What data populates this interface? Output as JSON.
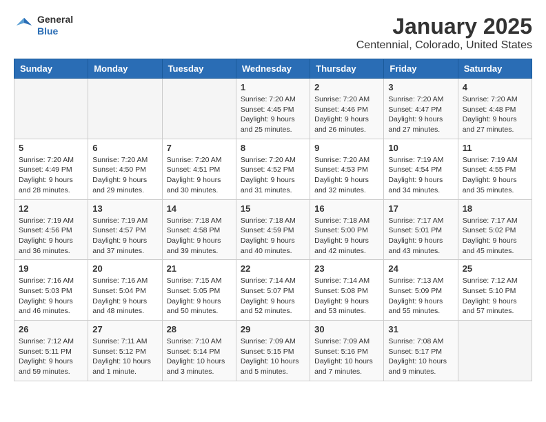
{
  "header": {
    "logo": {
      "general": "General",
      "blue": "Blue"
    },
    "title": "January 2025",
    "subtitle": "Centennial, Colorado, United States"
  },
  "weekdays": [
    "Sunday",
    "Monday",
    "Tuesday",
    "Wednesday",
    "Thursday",
    "Friday",
    "Saturday"
  ],
  "weeks": [
    [
      {
        "day": "",
        "sunrise": "",
        "sunset": "",
        "daylight": ""
      },
      {
        "day": "",
        "sunrise": "",
        "sunset": "",
        "daylight": ""
      },
      {
        "day": "",
        "sunrise": "",
        "sunset": "",
        "daylight": ""
      },
      {
        "day": "1",
        "sunrise": "Sunrise: 7:20 AM",
        "sunset": "Sunset: 4:45 PM",
        "daylight": "Daylight: 9 hours and 25 minutes."
      },
      {
        "day": "2",
        "sunrise": "Sunrise: 7:20 AM",
        "sunset": "Sunset: 4:46 PM",
        "daylight": "Daylight: 9 hours and 26 minutes."
      },
      {
        "day": "3",
        "sunrise": "Sunrise: 7:20 AM",
        "sunset": "Sunset: 4:47 PM",
        "daylight": "Daylight: 9 hours and 27 minutes."
      },
      {
        "day": "4",
        "sunrise": "Sunrise: 7:20 AM",
        "sunset": "Sunset: 4:48 PM",
        "daylight": "Daylight: 9 hours and 27 minutes."
      }
    ],
    [
      {
        "day": "5",
        "sunrise": "Sunrise: 7:20 AM",
        "sunset": "Sunset: 4:49 PM",
        "daylight": "Daylight: 9 hours and 28 minutes."
      },
      {
        "day": "6",
        "sunrise": "Sunrise: 7:20 AM",
        "sunset": "Sunset: 4:50 PM",
        "daylight": "Daylight: 9 hours and 29 minutes."
      },
      {
        "day": "7",
        "sunrise": "Sunrise: 7:20 AM",
        "sunset": "Sunset: 4:51 PM",
        "daylight": "Daylight: 9 hours and 30 minutes."
      },
      {
        "day": "8",
        "sunrise": "Sunrise: 7:20 AM",
        "sunset": "Sunset: 4:52 PM",
        "daylight": "Daylight: 9 hours and 31 minutes."
      },
      {
        "day": "9",
        "sunrise": "Sunrise: 7:20 AM",
        "sunset": "Sunset: 4:53 PM",
        "daylight": "Daylight: 9 hours and 32 minutes."
      },
      {
        "day": "10",
        "sunrise": "Sunrise: 7:19 AM",
        "sunset": "Sunset: 4:54 PM",
        "daylight": "Daylight: 9 hours and 34 minutes."
      },
      {
        "day": "11",
        "sunrise": "Sunrise: 7:19 AM",
        "sunset": "Sunset: 4:55 PM",
        "daylight": "Daylight: 9 hours and 35 minutes."
      }
    ],
    [
      {
        "day": "12",
        "sunrise": "Sunrise: 7:19 AM",
        "sunset": "Sunset: 4:56 PM",
        "daylight": "Daylight: 9 hours and 36 minutes."
      },
      {
        "day": "13",
        "sunrise": "Sunrise: 7:19 AM",
        "sunset": "Sunset: 4:57 PM",
        "daylight": "Daylight: 9 hours and 37 minutes."
      },
      {
        "day": "14",
        "sunrise": "Sunrise: 7:18 AM",
        "sunset": "Sunset: 4:58 PM",
        "daylight": "Daylight: 9 hours and 39 minutes."
      },
      {
        "day": "15",
        "sunrise": "Sunrise: 7:18 AM",
        "sunset": "Sunset: 4:59 PM",
        "daylight": "Daylight: 9 hours and 40 minutes."
      },
      {
        "day": "16",
        "sunrise": "Sunrise: 7:18 AM",
        "sunset": "Sunset: 5:00 PM",
        "daylight": "Daylight: 9 hours and 42 minutes."
      },
      {
        "day": "17",
        "sunrise": "Sunrise: 7:17 AM",
        "sunset": "Sunset: 5:01 PM",
        "daylight": "Daylight: 9 hours and 43 minutes."
      },
      {
        "day": "18",
        "sunrise": "Sunrise: 7:17 AM",
        "sunset": "Sunset: 5:02 PM",
        "daylight": "Daylight: 9 hours and 45 minutes."
      }
    ],
    [
      {
        "day": "19",
        "sunrise": "Sunrise: 7:16 AM",
        "sunset": "Sunset: 5:03 PM",
        "daylight": "Daylight: 9 hours and 46 minutes."
      },
      {
        "day": "20",
        "sunrise": "Sunrise: 7:16 AM",
        "sunset": "Sunset: 5:04 PM",
        "daylight": "Daylight: 9 hours and 48 minutes."
      },
      {
        "day": "21",
        "sunrise": "Sunrise: 7:15 AM",
        "sunset": "Sunset: 5:05 PM",
        "daylight": "Daylight: 9 hours and 50 minutes."
      },
      {
        "day": "22",
        "sunrise": "Sunrise: 7:14 AM",
        "sunset": "Sunset: 5:07 PM",
        "daylight": "Daylight: 9 hours and 52 minutes."
      },
      {
        "day": "23",
        "sunrise": "Sunrise: 7:14 AM",
        "sunset": "Sunset: 5:08 PM",
        "daylight": "Daylight: 9 hours and 53 minutes."
      },
      {
        "day": "24",
        "sunrise": "Sunrise: 7:13 AM",
        "sunset": "Sunset: 5:09 PM",
        "daylight": "Daylight: 9 hours and 55 minutes."
      },
      {
        "day": "25",
        "sunrise": "Sunrise: 7:12 AM",
        "sunset": "Sunset: 5:10 PM",
        "daylight": "Daylight: 9 hours and 57 minutes."
      }
    ],
    [
      {
        "day": "26",
        "sunrise": "Sunrise: 7:12 AM",
        "sunset": "Sunset: 5:11 PM",
        "daylight": "Daylight: 9 hours and 59 minutes."
      },
      {
        "day": "27",
        "sunrise": "Sunrise: 7:11 AM",
        "sunset": "Sunset: 5:12 PM",
        "daylight": "Daylight: 10 hours and 1 minute."
      },
      {
        "day": "28",
        "sunrise": "Sunrise: 7:10 AM",
        "sunset": "Sunset: 5:14 PM",
        "daylight": "Daylight: 10 hours and 3 minutes."
      },
      {
        "day": "29",
        "sunrise": "Sunrise: 7:09 AM",
        "sunset": "Sunset: 5:15 PM",
        "daylight": "Daylight: 10 hours and 5 minutes."
      },
      {
        "day": "30",
        "sunrise": "Sunrise: 7:09 AM",
        "sunset": "Sunset: 5:16 PM",
        "daylight": "Daylight: 10 hours and 7 minutes."
      },
      {
        "day": "31",
        "sunrise": "Sunrise: 7:08 AM",
        "sunset": "Sunset: 5:17 PM",
        "daylight": "Daylight: 10 hours and 9 minutes."
      },
      {
        "day": "",
        "sunrise": "",
        "sunset": "",
        "daylight": ""
      }
    ]
  ]
}
